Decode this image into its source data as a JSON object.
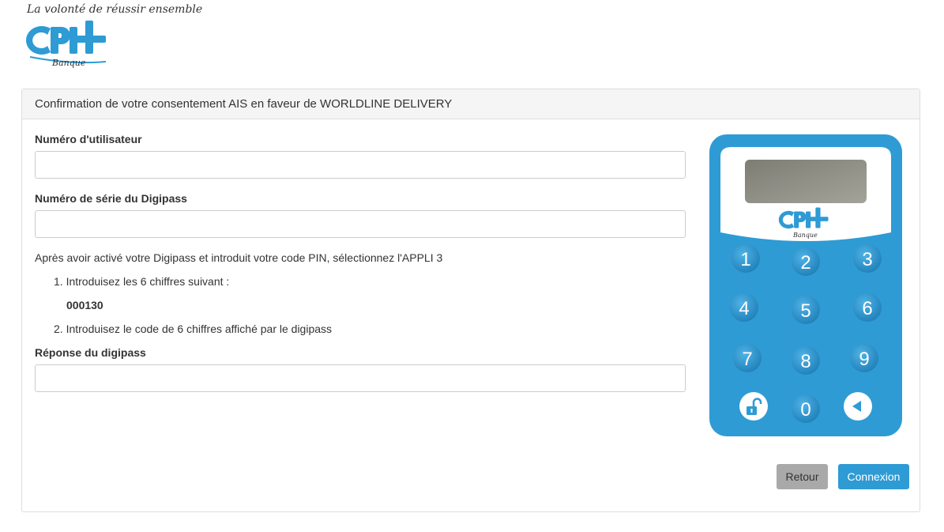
{
  "header": {
    "tagline": "La volonté de réussir ensemble",
    "logo_text": "CPH",
    "logo_sub": "Banque"
  },
  "panel": {
    "title": "Confirmation de votre consentement AIS en faveur de WORLDLINE DELIVERY"
  },
  "form": {
    "user_label": "Numéro d'utilisateur",
    "user_value": "",
    "serial_label": "Numéro de série du Digipass",
    "serial_value": "",
    "instructions": "Après avoir activé votre Digipass et introduit votre code PIN, sélectionnez l'APPLI 3",
    "step1": "1. Introduisez les 6 chiffres suivant :",
    "challenge_code": "000130",
    "step2": "2. Introduisez le code de 6 chiffres affiché par le digipass",
    "response_label": "Réponse du digipass",
    "response_value": ""
  },
  "digipass": {
    "keys": [
      "1",
      "2",
      "3",
      "4",
      "5",
      "6",
      "7",
      "8",
      "9",
      "0"
    ],
    "logo_text": "CPH",
    "logo_sub": "Banque",
    "colors": {
      "body": "#2e9bd4",
      "screen": "#8c8c82"
    }
  },
  "buttons": {
    "back_label": "Retour",
    "login_label": "Connexion"
  },
  "colors": {
    "accent": "#2e9bd4",
    "back_button": "#a9a9a9"
  }
}
